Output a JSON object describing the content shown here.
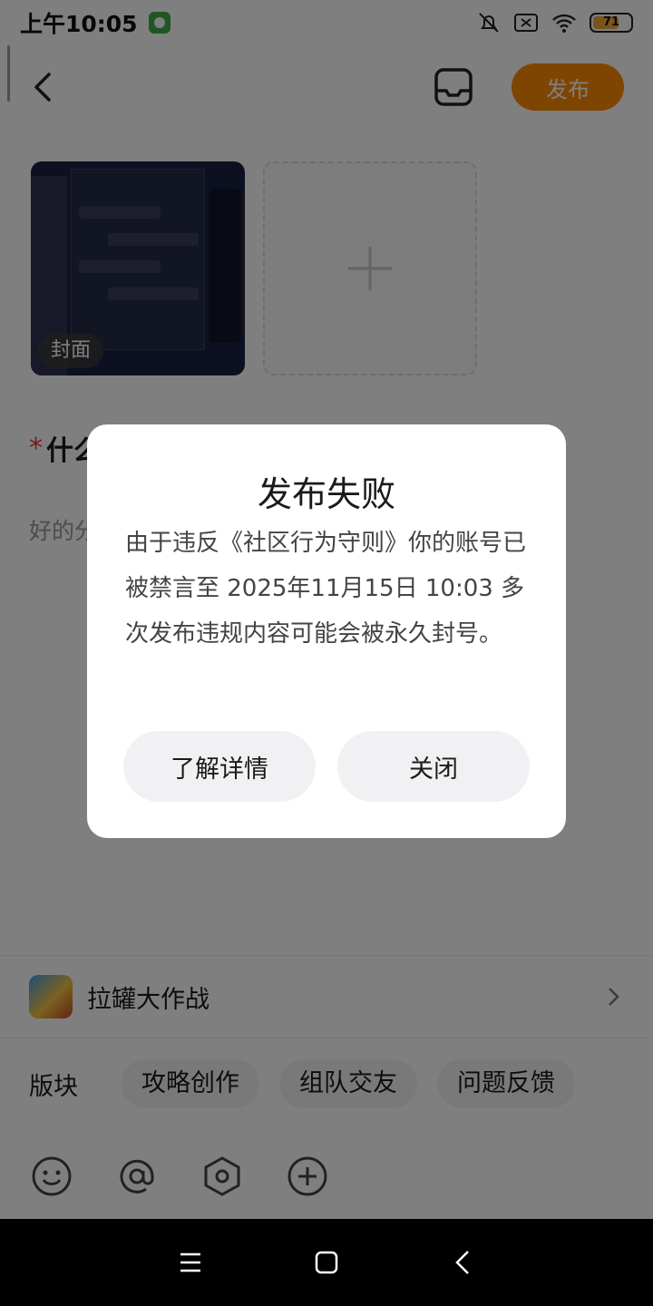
{
  "status_bar": {
    "time": "上午10:05",
    "battery_level": 71,
    "battery_text": "71",
    "icons": [
      "app-notification-icon",
      "silent-bell-icon",
      "sim-off-icon",
      "wifi-icon",
      "battery-icon"
    ]
  },
  "header": {
    "back_icon": "back-arrow-icon",
    "drafts_icon": "inbox-tray-icon",
    "publish_label": "发布",
    "accent_color": "#fd8a00"
  },
  "images": {
    "cover_label": "封面",
    "add_icon": "plus-icon"
  },
  "post": {
    "title_prefix": "*",
    "title_visible": "什么",
    "body_visible": "好的分"
  },
  "game": {
    "name": "拉罐大作战",
    "chevron": "chevron-right-icon"
  },
  "sections": {
    "label": "版块",
    "tags": [
      "攻略创作",
      "组队交友",
      "问题反馈"
    ]
  },
  "toolbar": {
    "icons": [
      "emoji-icon",
      "at-mention-icon",
      "hexagon-tag-icon",
      "add-circle-icon"
    ]
  },
  "dialog": {
    "title": "发布失败",
    "message": "由于违反《社区行为守则》你的账号已被禁言至 2025年11月15日 10:03 多次发布违规内容可能会被永久封号。",
    "details_button": "了解详情",
    "close_button": "关闭"
  },
  "nav_bar": {
    "icons": [
      "menu-icon",
      "home-square-icon",
      "back-chevron-icon"
    ]
  }
}
